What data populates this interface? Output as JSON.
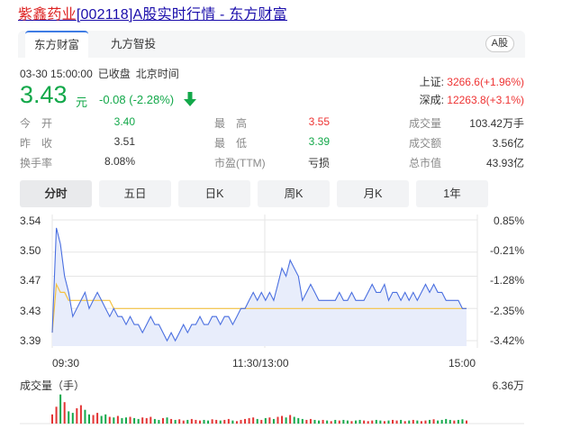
{
  "header": {
    "name": "紫鑫药业",
    "code": "[002118]",
    "suffix": "A股实时行情 - 东方财富"
  },
  "tabs": [
    {
      "label": "东方财富",
      "active": true
    },
    {
      "label": "九方智投",
      "active": false
    }
  ],
  "market_tag": "A股",
  "status": {
    "datetime": "03-30 15:00:00",
    "state": "已收盘",
    "tz": "北京时间"
  },
  "quote": {
    "price": "3.43",
    "unit": "元",
    "change": "-0.08 (-2.28%)"
  },
  "indices": [
    {
      "label": "上证:",
      "value": "3266.6(+1.96%)"
    },
    {
      "label": "深成:",
      "value": "12263.8(+3.1%)"
    }
  ],
  "stats": {
    "open_label": "今　开",
    "open": "3.40",
    "prev_label": "昨　收",
    "prev": "3.51",
    "turnover_label": "换手率",
    "turnover": "8.08%",
    "high_label": "最　高",
    "high": "3.55",
    "low_label": "最　低",
    "low": "3.39",
    "pe_label": "市盈(TTM)",
    "pe": "亏损",
    "vol_label": "成交量",
    "vol": "103.42万手",
    "amt_label": "成交额",
    "amt": "3.56亿",
    "cap_label": "总市值",
    "cap": "43.93亿"
  },
  "periods": [
    "分时",
    "五日",
    "日K",
    "周K",
    "月K",
    "1年"
  ],
  "colors": {
    "price_line": "#4a6fe0",
    "avg_line": "#f5c242",
    "fill": "#e8edfb",
    "grid": "#e6e6e6",
    "up": "#e33333",
    "down": "#13a84a",
    "accent": "#3f7ce4"
  },
  "chart_data": {
    "type": "line",
    "title": "",
    "x_ticks": [
      "09:30",
      "11:30/13:00",
      "15:00"
    ],
    "y_ticks_left": [
      "3.54",
      "3.50",
      "3.47",
      "3.43",
      "3.39"
    ],
    "y_ticks_right": [
      "0.85%",
      "-0.21%",
      "-1.28%",
      "-2.35%",
      "-3.42%"
    ],
    "ylim": [
      3.39,
      3.54
    ],
    "sessions_minutes": 240,
    "series": [
      {
        "values": [
          3.4,
          3.53,
          3.51,
          3.47,
          3.45,
          3.42,
          3.43,
          3.44,
          3.45,
          3.43,
          3.44,
          3.45,
          3.44,
          3.43,
          3.42,
          3.43,
          3.42,
          3.42,
          3.41,
          3.42,
          3.41,
          3.41,
          3.4,
          3.41,
          3.42,
          3.41,
          3.41,
          3.4,
          3.39,
          3.4,
          3.39,
          3.4,
          3.41,
          3.4,
          3.41,
          3.41,
          3.42,
          3.41,
          3.41,
          3.42,
          3.42,
          3.41,
          3.42,
          3.42,
          3.41,
          3.42,
          3.43,
          3.43,
          3.44,
          3.45,
          3.44,
          3.45,
          3.44,
          3.45,
          3.44,
          3.46,
          3.48,
          3.47,
          3.49,
          3.48,
          3.47,
          3.44,
          3.45,
          3.46,
          3.45,
          3.44,
          3.44,
          3.44,
          3.44,
          3.44,
          3.45,
          3.44,
          3.44,
          3.45,
          3.44,
          3.44,
          3.44,
          3.45,
          3.46,
          3.45,
          3.45,
          3.46,
          3.44,
          3.45,
          3.45,
          3.44,
          3.45,
          3.44,
          3.45,
          3.44,
          3.45,
          3.46,
          3.45,
          3.46,
          3.45,
          3.45,
          3.44,
          3.44,
          3.44,
          3.44,
          3.43,
          3.43
        ]
      },
      {
        "values": [
          3.4,
          3.46,
          3.45,
          3.45,
          3.44,
          3.44,
          3.44,
          3.44,
          3.44,
          3.44,
          3.44,
          3.44,
          3.44,
          3.44,
          3.44,
          3.43,
          3.43,
          3.43,
          3.43,
          3.43,
          3.43,
          3.43,
          3.43,
          3.43,
          3.43,
          3.43,
          3.43,
          3.43,
          3.43,
          3.43,
          3.43,
          3.43,
          3.43,
          3.43,
          3.43,
          3.43,
          3.43,
          3.43,
          3.43,
          3.43,
          3.43,
          3.43,
          3.43,
          3.43,
          3.43,
          3.43,
          3.43,
          3.43,
          3.43,
          3.43,
          3.43,
          3.43,
          3.43,
          3.43,
          3.43,
          3.43,
          3.43,
          3.43,
          3.43,
          3.43,
          3.43,
          3.43,
          3.43,
          3.43,
          3.43,
          3.43,
          3.43,
          3.43,
          3.43,
          3.43,
          3.43,
          3.43,
          3.43,
          3.43,
          3.43,
          3.43,
          3.43,
          3.43,
          3.43,
          3.43,
          3.43,
          3.43,
          3.43,
          3.43,
          3.43,
          3.43,
          3.43,
          3.43,
          3.43,
          3.43,
          3.43,
          3.43,
          3.43,
          3.43,
          3.43,
          3.43,
          3.43,
          3.43,
          3.43,
          3.43,
          3.43,
          3.43
        ]
      }
    ],
    "volume_label": "成交量（手）",
    "volume_max": "6.36万",
    "volume": [
      0.3,
      0.55,
      0.95,
      0.7,
      0.4,
      0.35,
      0.5,
      0.6,
      0.45,
      0.3,
      0.28,
      0.35,
      0.25,
      0.3,
      0.22,
      0.2,
      0.25,
      0.18,
      0.2,
      0.22,
      0.18,
      0.15,
      0.2,
      0.18,
      0.22,
      0.15,
      0.12,
      0.18,
      0.2,
      0.15,
      0.12,
      0.14,
      0.1,
      0.12,
      0.15,
      0.12,
      0.1,
      0.12,
      0.1,
      0.14,
      0.12,
      0.1,
      0.12,
      0.15,
      0.1,
      0.08,
      0.12,
      0.15,
      0.18,
      0.2,
      0.15,
      0.12,
      0.18,
      0.2,
      0.15,
      0.22,
      0.25,
      0.2,
      0.28,
      0.22,
      0.18,
      0.15,
      0.12,
      0.15,
      0.12,
      0.1,
      0.12,
      0.1,
      0.08,
      0.12,
      0.1,
      0.12,
      0.1,
      0.08,
      0.1,
      0.12,
      0.1,
      0.08,
      0.1,
      0.12,
      0.1,
      0.08,
      0.1,
      0.12,
      0.1,
      0.12,
      0.08,
      0.1,
      0.12,
      0.1,
      0.08,
      0.1,
      0.12,
      0.14,
      0.1,
      0.12,
      0.15,
      0.12,
      0.1,
      0.12,
      0.14,
      0.1
    ],
    "volume_up": [
      1,
      1,
      0,
      1,
      0,
      0,
      1,
      1,
      0,
      0,
      1,
      1,
      0,
      0,
      1,
      0,
      1,
      0,
      0,
      1,
      0,
      0,
      1,
      1,
      1,
      0,
      0,
      1,
      0,
      1,
      0,
      1,
      1,
      0,
      1,
      1,
      1,
      0,
      0,
      1,
      1,
      0,
      1,
      1,
      0,
      1,
      1,
      1,
      1,
      1,
      0,
      1,
      0,
      1,
      0,
      1,
      1,
      0,
      1,
      0,
      0,
      0,
      1,
      1,
      0,
      0,
      1,
      0,
      1,
      0,
      1,
      0,
      0,
      1,
      0,
      0,
      1,
      1,
      1,
      0,
      0,
      1,
      0,
      1,
      1,
      0,
      1,
      0,
      1,
      0,
      1,
      1,
      0,
      1,
      0,
      0,
      0,
      0,
      1,
      0,
      0,
      1
    ]
  }
}
